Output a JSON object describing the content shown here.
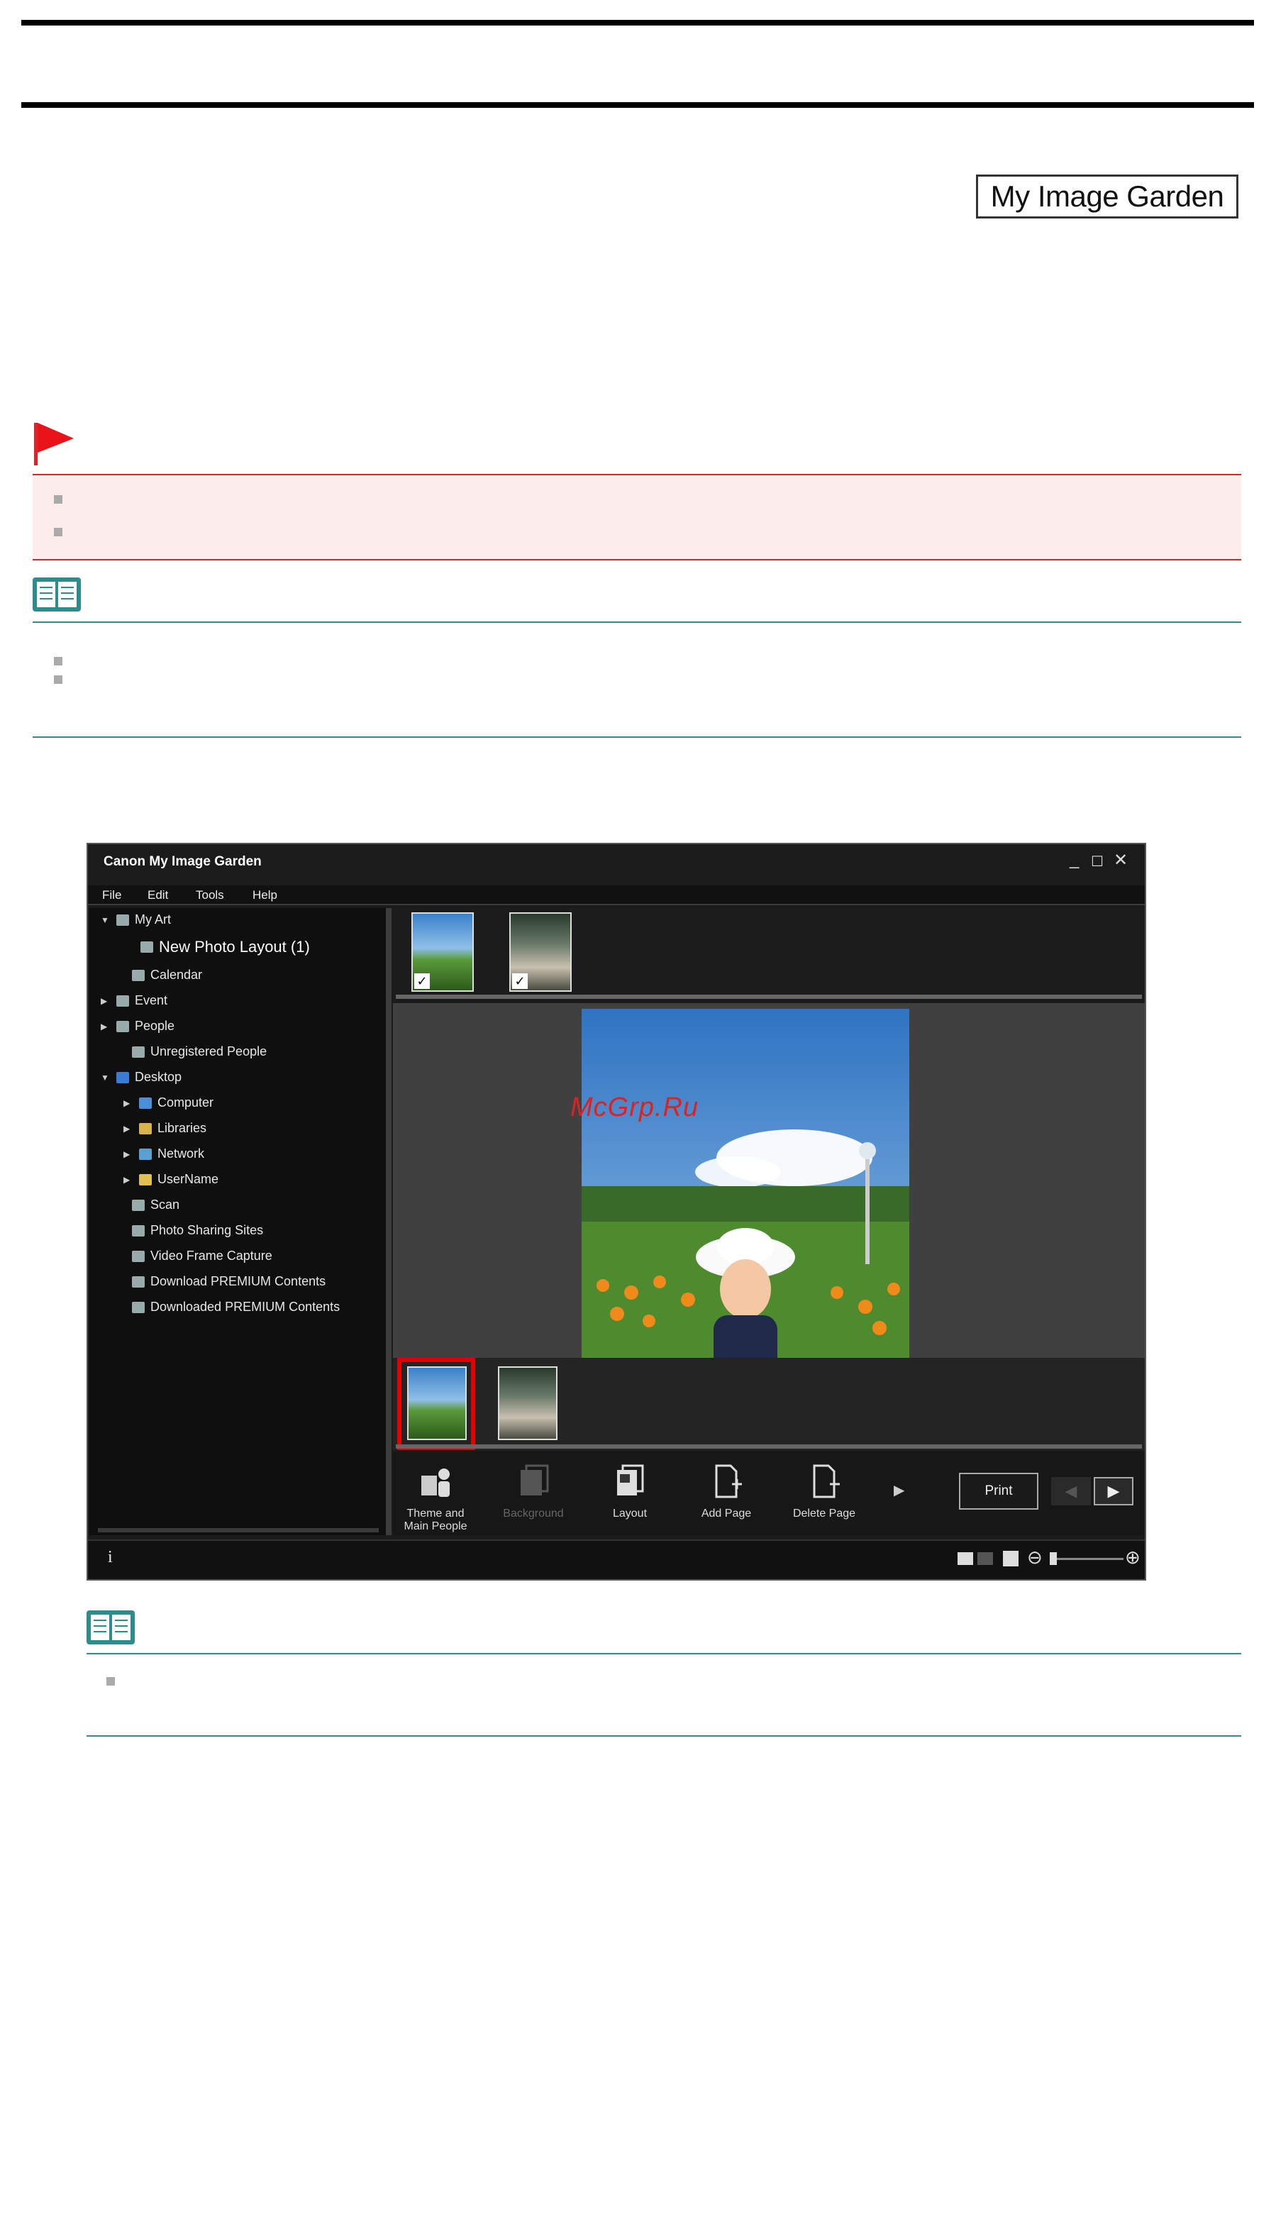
{
  "header": {
    "logo_text": "My Image Garden"
  },
  "app": {
    "title": "Canon My Image Garden",
    "menu": [
      "File",
      "Edit",
      "Tools",
      "Help"
    ],
    "tree": [
      {
        "label": "My Art",
        "expand": "▼"
      },
      {
        "label": "New Photo Layout (1)",
        "expand": ""
      },
      {
        "label": "Calendar",
        "expand": ""
      },
      {
        "label": "Event",
        "expand": "▶"
      },
      {
        "label": "People",
        "expand": "▶"
      },
      {
        "label": "Unregistered People",
        "expand": ""
      },
      {
        "label": "Desktop",
        "expand": "▼"
      },
      {
        "label": "Computer",
        "expand": "▶"
      },
      {
        "label": "Libraries",
        "expand": "▶"
      },
      {
        "label": "Network",
        "expand": "▶"
      },
      {
        "label": "UserName",
        "expand": "▶"
      },
      {
        "label": "Scan",
        "expand": ""
      },
      {
        "label": "Photo Sharing Sites",
        "expand": ""
      },
      {
        "label": "Video Frame Capture",
        "expand": ""
      },
      {
        "label": "Download PREMIUM Contents",
        "expand": ""
      },
      {
        "label": "Downloaded PREMIUM Contents",
        "expand": ""
      }
    ],
    "toolbar": {
      "theme_line1": "Theme and",
      "theme_line2": "Main People",
      "background": "Background",
      "layout": "Layout",
      "add_page": "Add Page",
      "delete_page": "Delete Page",
      "print": "Print"
    },
    "status_info": "i"
  },
  "watermark": "McGrp.Ru",
  "colors": {
    "important_red": "#d9262b",
    "note_teal": "#2e8c8c",
    "highlight": "#e00000"
  }
}
